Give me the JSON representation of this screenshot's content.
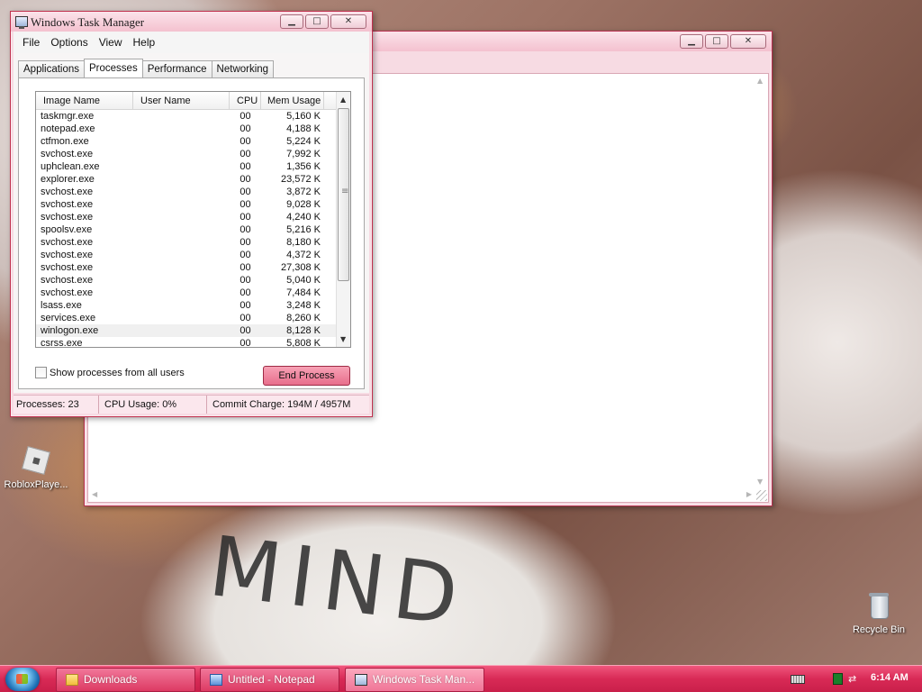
{
  "desktop": {
    "icons": [
      {
        "label": "RobloxPlaye..."
      },
      {
        "label": "Recycle Bin"
      }
    ],
    "wallpaper_text": "MIND"
  },
  "notepad": {
    "title": "Untitled - Notepad"
  },
  "taskmgr": {
    "title": "Windows Task Manager",
    "menu": [
      "File",
      "Options",
      "View",
      "Help"
    ],
    "tabs": [
      "Applications",
      "Processes",
      "Performance",
      "Networking"
    ],
    "active_tab": "Processes",
    "columns": [
      "Image Name",
      "User Name",
      "CPU",
      "Mem Usage"
    ],
    "rows": [
      {
        "name": "taskmgr.exe",
        "user": "",
        "cpu": "00",
        "mem": "5,160 K"
      },
      {
        "name": "notepad.exe",
        "user": "",
        "cpu": "00",
        "mem": "4,188 K"
      },
      {
        "name": "ctfmon.exe",
        "user": "",
        "cpu": "00",
        "mem": "5,224 K"
      },
      {
        "name": "svchost.exe",
        "user": "",
        "cpu": "00",
        "mem": "7,992 K"
      },
      {
        "name": "uphclean.exe",
        "user": "",
        "cpu": "00",
        "mem": "1,356 K"
      },
      {
        "name": "explorer.exe",
        "user": "",
        "cpu": "00",
        "mem": "23,572 K"
      },
      {
        "name": "svchost.exe",
        "user": "",
        "cpu": "00",
        "mem": "3,872 K"
      },
      {
        "name": "svchost.exe",
        "user": "",
        "cpu": "00",
        "mem": "9,028 K"
      },
      {
        "name": "svchost.exe",
        "user": "",
        "cpu": "00",
        "mem": "4,240 K"
      },
      {
        "name": "spoolsv.exe",
        "user": "",
        "cpu": "00",
        "mem": "5,216 K"
      },
      {
        "name": "svchost.exe",
        "user": "",
        "cpu": "00",
        "mem": "8,180 K"
      },
      {
        "name": "svchost.exe",
        "user": "",
        "cpu": "00",
        "mem": "4,372 K"
      },
      {
        "name": "svchost.exe",
        "user": "",
        "cpu": "00",
        "mem": "27,308 K"
      },
      {
        "name": "svchost.exe",
        "user": "",
        "cpu": "00",
        "mem": "5,040 K"
      },
      {
        "name": "svchost.exe",
        "user": "",
        "cpu": "00",
        "mem": "7,484 K"
      },
      {
        "name": "lsass.exe",
        "user": "",
        "cpu": "00",
        "mem": "3,248 K"
      },
      {
        "name": "services.exe",
        "user": "",
        "cpu": "00",
        "mem": "8,260 K"
      },
      {
        "name": "winlogon.exe",
        "user": "",
        "cpu": "00",
        "mem": "8,128 K"
      },
      {
        "name": "csrss.exe",
        "user": "",
        "cpu": "00",
        "mem": "5,808 K"
      }
    ],
    "show_all_label": "Show processes from all users",
    "end_process_label": "End Process",
    "status": {
      "processes": "Processes: 23",
      "cpu": "CPU Usage: 0%",
      "commit": "Commit Charge: 194M / 4957M"
    }
  },
  "taskbar": {
    "buttons": [
      {
        "label": "Downloads",
        "icon": "folder-icon"
      },
      {
        "label": "Untitled - Notepad",
        "icon": "notepad-icon"
      },
      {
        "label": "Windows Task Man...",
        "icon": "task-manager-icon"
      }
    ],
    "clock": "6:14 AM"
  },
  "colors": {
    "accent": "#e0305a",
    "window_frame": "#f7dbe3"
  }
}
